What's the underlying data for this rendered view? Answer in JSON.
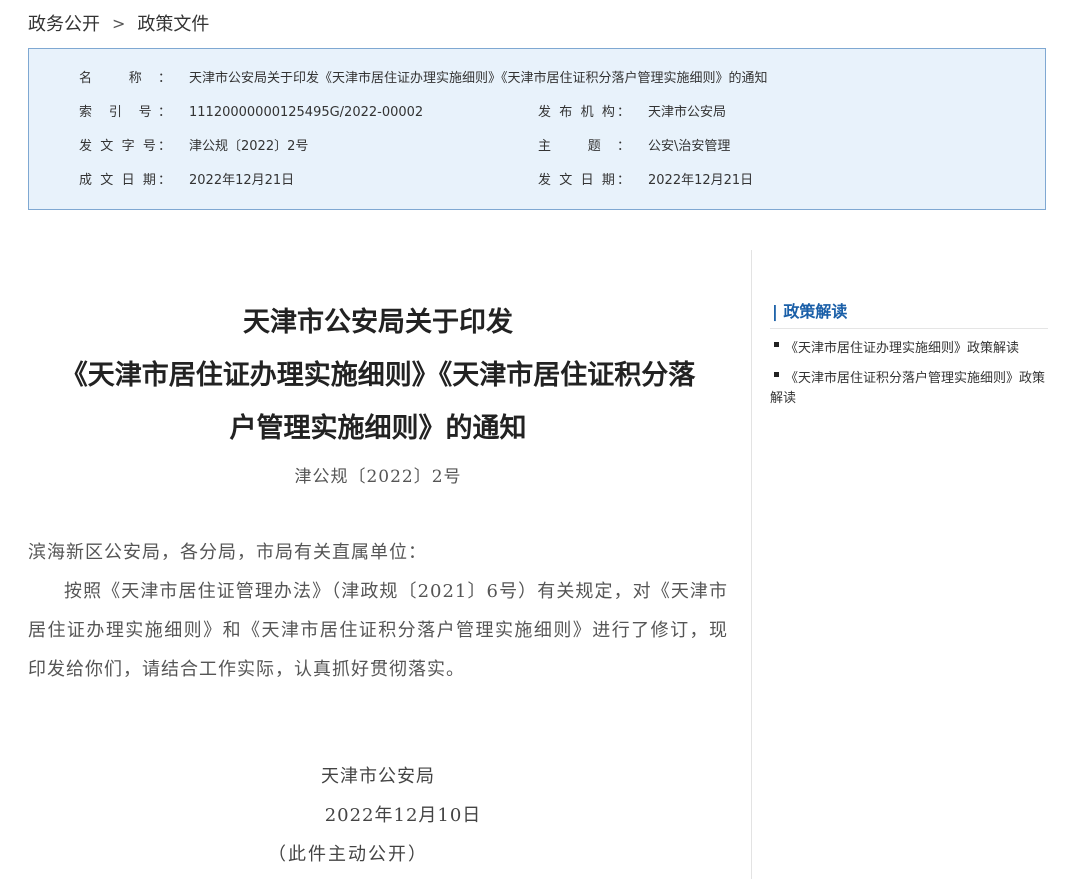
{
  "breadcrumb": {
    "home": "政务公开",
    "separator": ">",
    "current": "政策文件"
  },
  "meta": {
    "name_label": "名 称：",
    "name_value": "天津市公安局关于印发《天津市居住证办理实施细则》《天津市居住证积分落户管理实施细则》的通知",
    "index_label": "索 引 号：",
    "index_value": "11120000000125495G/2022-00002",
    "issuer_label": "发 布 机 构：",
    "issuer_value": "天津市公安局",
    "docno_label": "发 文 字 号：",
    "docno_value": "津公规〔2022〕2号",
    "topic_label": "主 题：",
    "topic_value": "公安\\治安管理",
    "created_label": "成 文 日 期：",
    "created_value": "2022年12月21日",
    "published_label": "发 文 日 期：",
    "published_value": "2022年12月21日"
  },
  "document": {
    "title_line1": "天津市公安局关于印发",
    "title_line2": "《天津市居住证办理实施细则》《天津市居住证积分落",
    "title_line3": "户管理实施细则》的通知",
    "number": "津公规〔2022〕2号",
    "salutation": "滨海新区公安局，各分局，市局有关直属单位：",
    "body": "按照《天津市居住证管理办法》（津政规〔2021〕6号）有关规定，对《天津市居住证办理实施细则》和《天津市居住证积分落户管理实施细则》进行了修订，现印发给你们，请结合工作实际，认真抓好贯彻落实。",
    "signature_org": "天津市公安局",
    "signature_date": "2022年12月10日",
    "public_note": "（此件主动公开）"
  },
  "sidebar": {
    "heading": "| 政策解读",
    "items": [
      "《天津市居住证办理实施细则》政策解读",
      "《天津市居住证积分落户管理实施细则》政策解读"
    ]
  },
  "colors": {
    "accent": "#1a5fa8",
    "meta_background": "#e8f2fb",
    "meta_border": "#7fa8d2"
  }
}
